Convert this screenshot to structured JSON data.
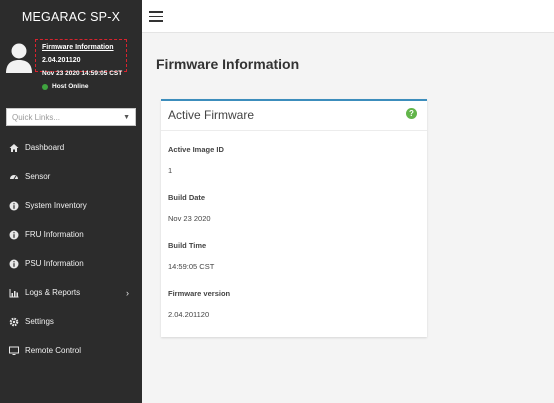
{
  "sidebar": {
    "brand": "MEGARAC SP-X",
    "user": {
      "firmware_link": "Firmware Information",
      "firmware_version": "2.04.201120",
      "datetime": "Nov 23 2020 14:59:05 CST",
      "host_status": "Host Online",
      "status_color": "#3fa33f"
    },
    "quick_links": {
      "placeholder": "Quick Links..."
    },
    "nav": [
      {
        "label": "Dashboard",
        "icon": "dashboard-icon"
      },
      {
        "label": "Sensor",
        "icon": "sensor-icon"
      },
      {
        "label": "System Inventory",
        "icon": "info-circle-icon"
      },
      {
        "label": "FRU Information",
        "icon": "info-circle-icon"
      },
      {
        "label": "PSU Information",
        "icon": "info-circle-icon"
      },
      {
        "label": "Logs & Reports",
        "icon": "bar-chart-icon"
      },
      {
        "label": "Settings",
        "icon": "gear-icon"
      },
      {
        "label": "Remote Control",
        "icon": "monitor-icon"
      }
    ]
  },
  "main": {
    "page_title": "Firmware Information",
    "card": {
      "title": "Active Firmware",
      "fields": [
        {
          "label": "Active Image ID",
          "value": "1"
        },
        {
          "label": "Build Date",
          "value": "Nov 23 2020"
        },
        {
          "label": "Build Time",
          "value": "14:59:05 CST"
        },
        {
          "label": "Firmware version",
          "value": "2.04.201120"
        }
      ]
    }
  },
  "colors": {
    "sidebar_bg": "#2c2c2c",
    "accent": "#3c8dbc",
    "highlight": "#d9232e",
    "help": "#62b54a"
  }
}
